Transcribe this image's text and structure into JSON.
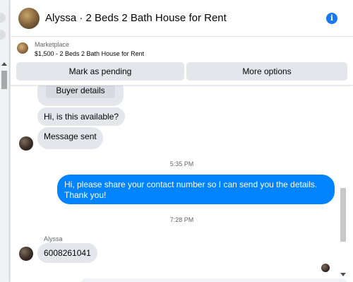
{
  "header": {
    "title": "Alyssa · 2 Beds 2 Bath House for Rent",
    "info_icon": "info-icon"
  },
  "marketplace": {
    "label": "Marketplace",
    "item": "$1,500 - 2 Beds 2 Bath House for Rent",
    "buttons": {
      "mark_pending": "Mark as pending",
      "more_options": "More options"
    }
  },
  "messages": {
    "buyer_details_label": "Buyer details",
    "incoming_1": "Hi, is this available?",
    "incoming_2": "Message sent",
    "timestamp_1": "5:35 PM",
    "outgoing_1": "Hi, please share your contact number so I can send you the details. Thank you!",
    "timestamp_2": "7:28 PM",
    "sender_name": "Alyssa",
    "incoming_3": "6008261041"
  },
  "colors": {
    "accent": "#0084ff",
    "bubble_gray": "#e4e6eb",
    "info_blue": "#1877f2"
  }
}
